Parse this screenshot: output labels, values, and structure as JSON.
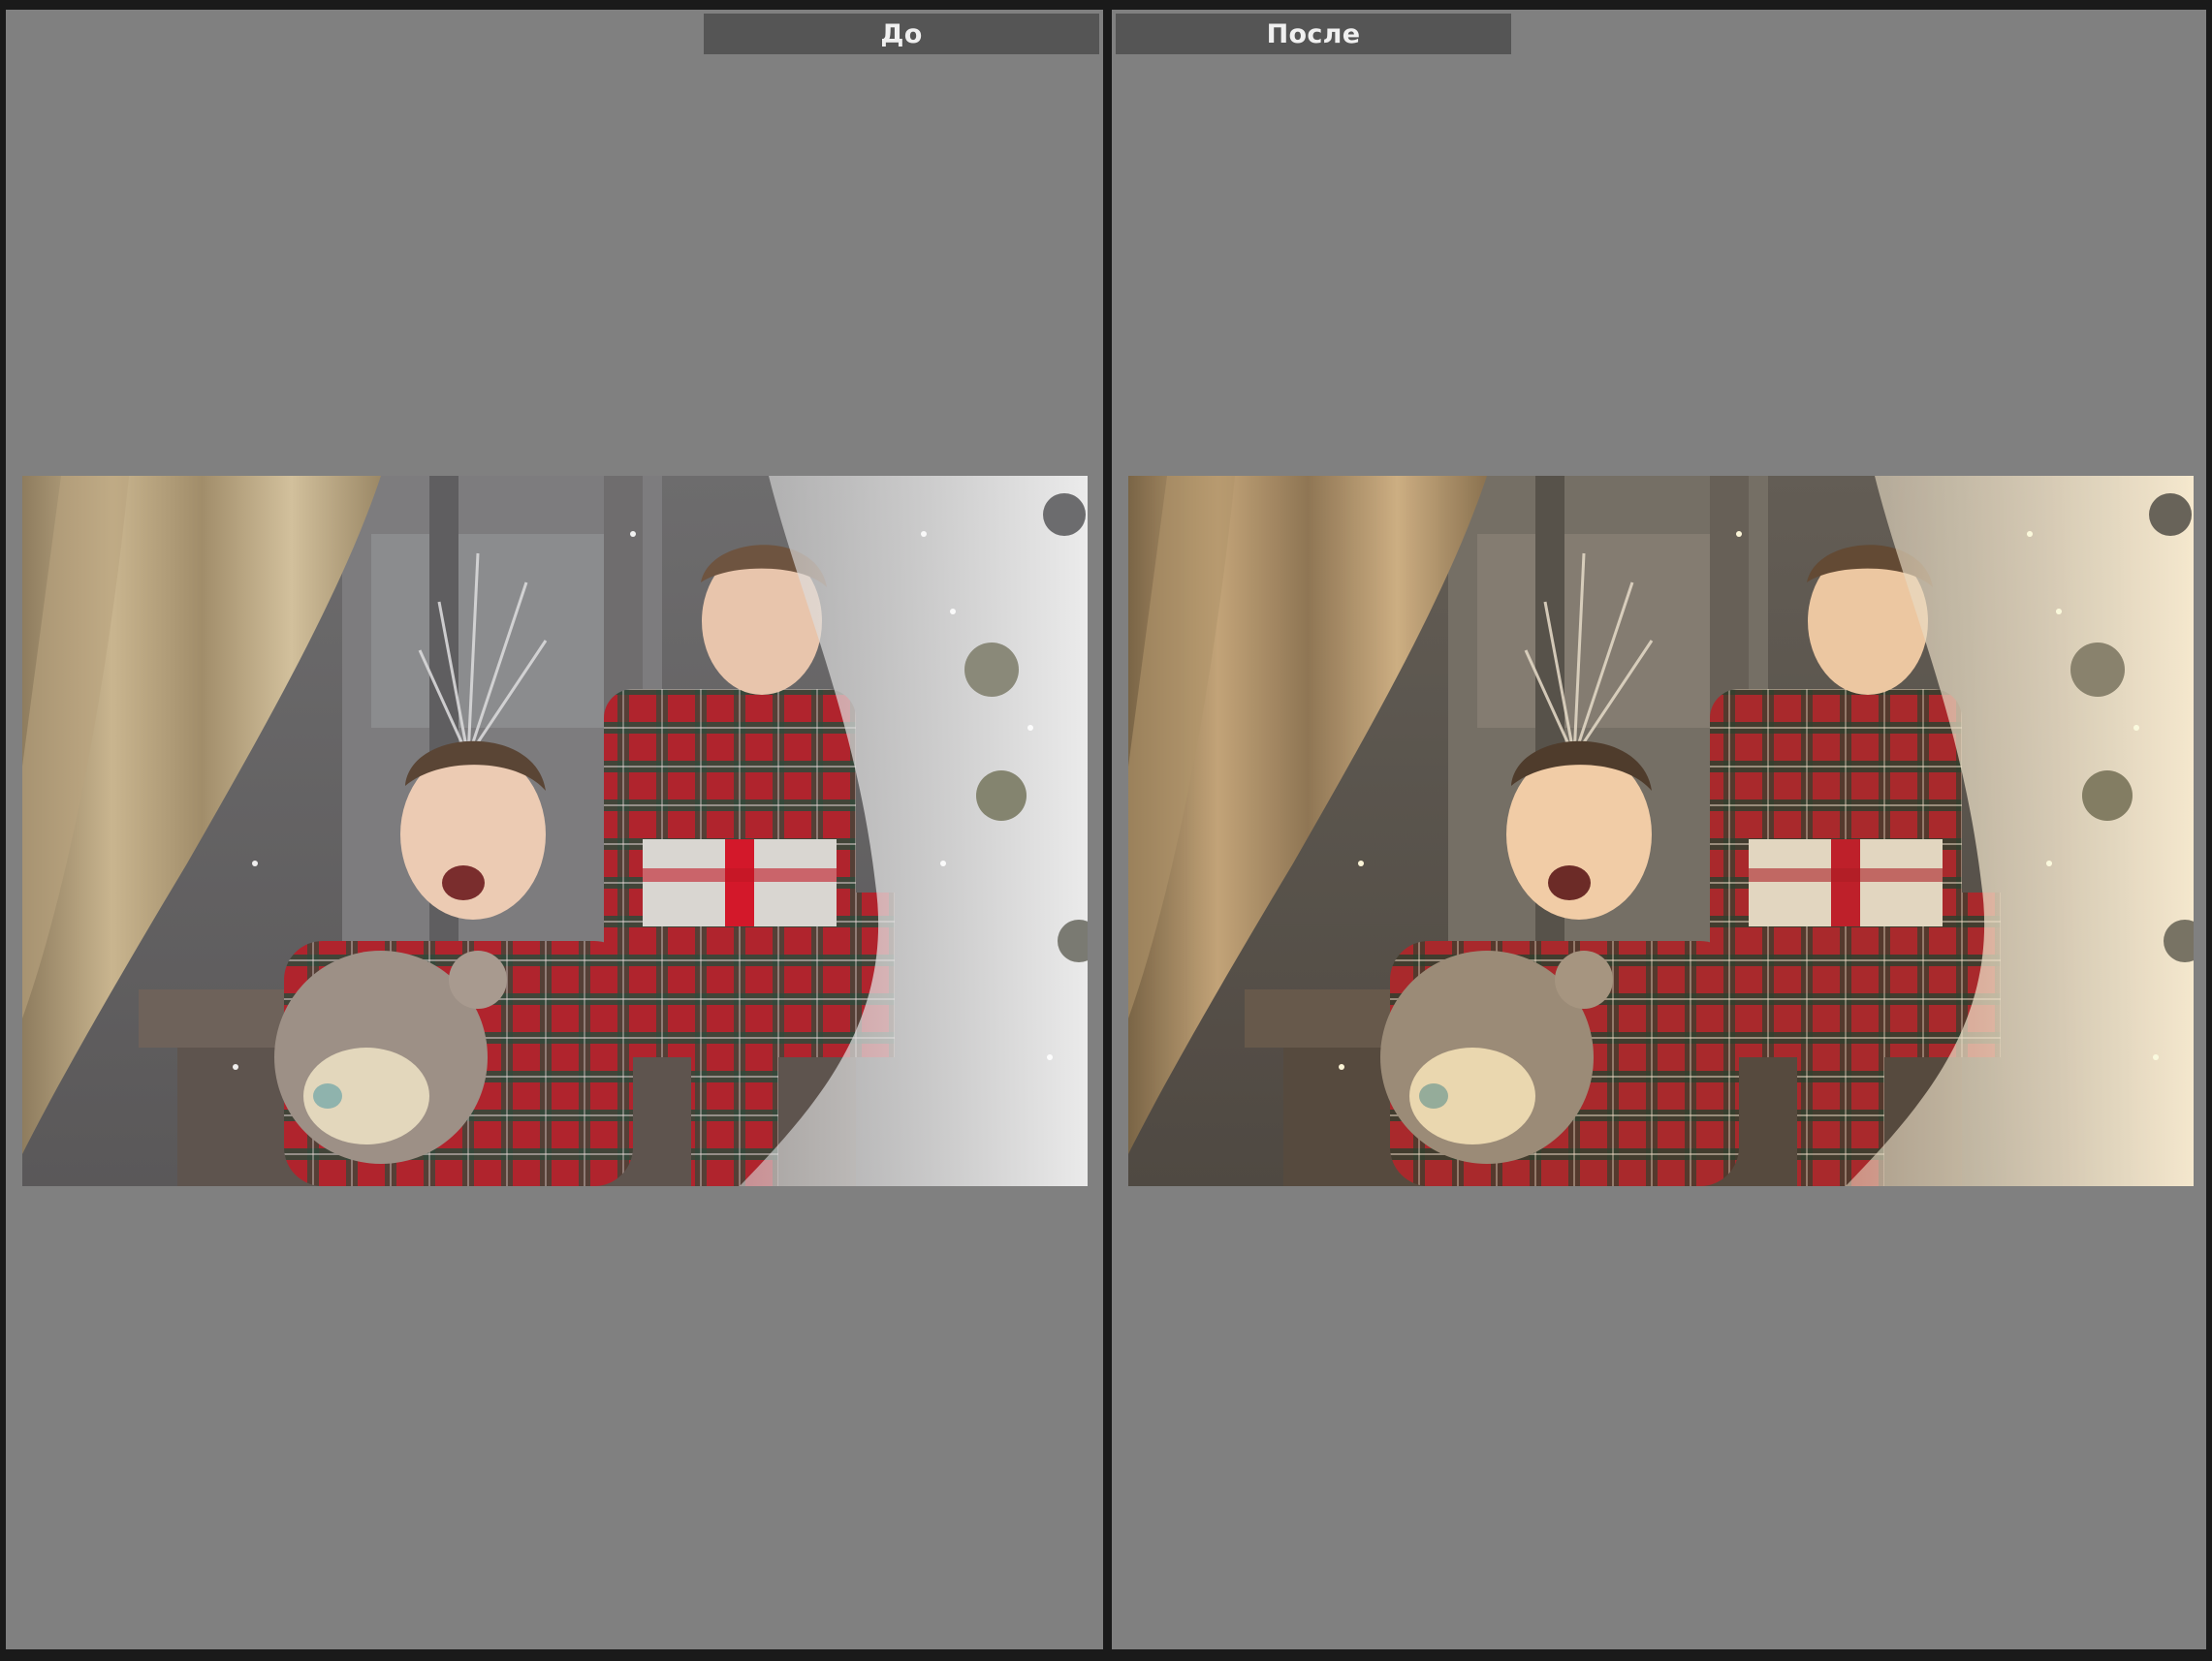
{
  "compare_view": {
    "before_label": "До",
    "after_label": "После"
  },
  "colors": {
    "background": "#808080",
    "frame": "#1a1a1a",
    "label_bar": "#555555",
    "label_text": "#f0f0f0"
  },
  "photo": {
    "subject": "photo"
  }
}
